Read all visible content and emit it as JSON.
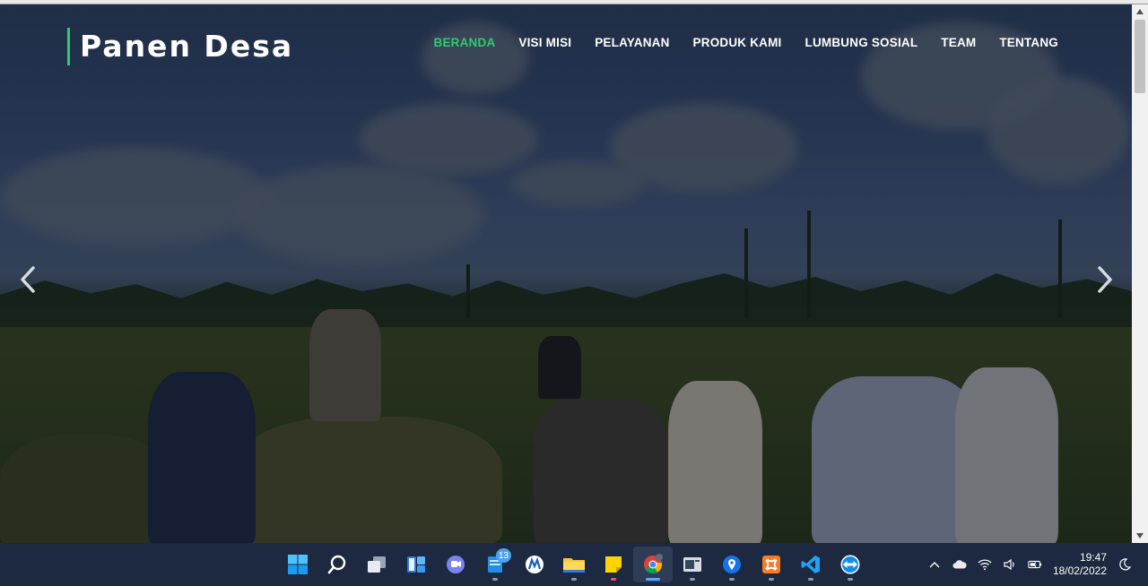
{
  "site": {
    "brand": "Panen Desa",
    "accent_color": "#2ecc71",
    "nav": [
      {
        "label": "BERANDA",
        "active": true
      },
      {
        "label": "VISI MISI",
        "active": false
      },
      {
        "label": "PELAYANAN",
        "active": false
      },
      {
        "label": "PRODUK KAMI",
        "active": false
      },
      {
        "label": "LUMBUNG SOSIAL",
        "active": false
      },
      {
        "label": "TEAM",
        "active": false
      },
      {
        "label": "TENTANG",
        "active": false
      }
    ],
    "carousel": {
      "prev_icon": "chevron-left-icon",
      "next_icon": "chevron-right-icon"
    },
    "hero_image": "farmers harvesting rice field"
  },
  "taskbar": {
    "apps": [
      {
        "name": "windows-start-icon",
        "indicator": false
      },
      {
        "name": "search-icon",
        "indicator": false
      },
      {
        "name": "task-view-icon",
        "indicator": false
      },
      {
        "name": "widgets-icon",
        "indicator": false
      },
      {
        "name": "teams-chat-icon",
        "indicator": false
      },
      {
        "name": "mail-icon",
        "indicator": true,
        "badge": "13"
      },
      {
        "name": "office-icon",
        "indicator": false
      },
      {
        "name": "file-explorer-icon",
        "indicator": true
      },
      {
        "name": "sticky-notes-icon",
        "indicator": true
      },
      {
        "name": "chrome-icon",
        "indicator": true,
        "active": true
      },
      {
        "name": "image-viewer-icon",
        "indicator": true
      },
      {
        "name": "maps-icon",
        "indicator": true
      },
      {
        "name": "xampp-icon",
        "indicator": true
      },
      {
        "name": "vscode-icon",
        "indicator": true
      },
      {
        "name": "teamviewer-icon",
        "indicator": true
      }
    ],
    "tray": {
      "time": "19:47",
      "date": "18/02/2022"
    }
  }
}
